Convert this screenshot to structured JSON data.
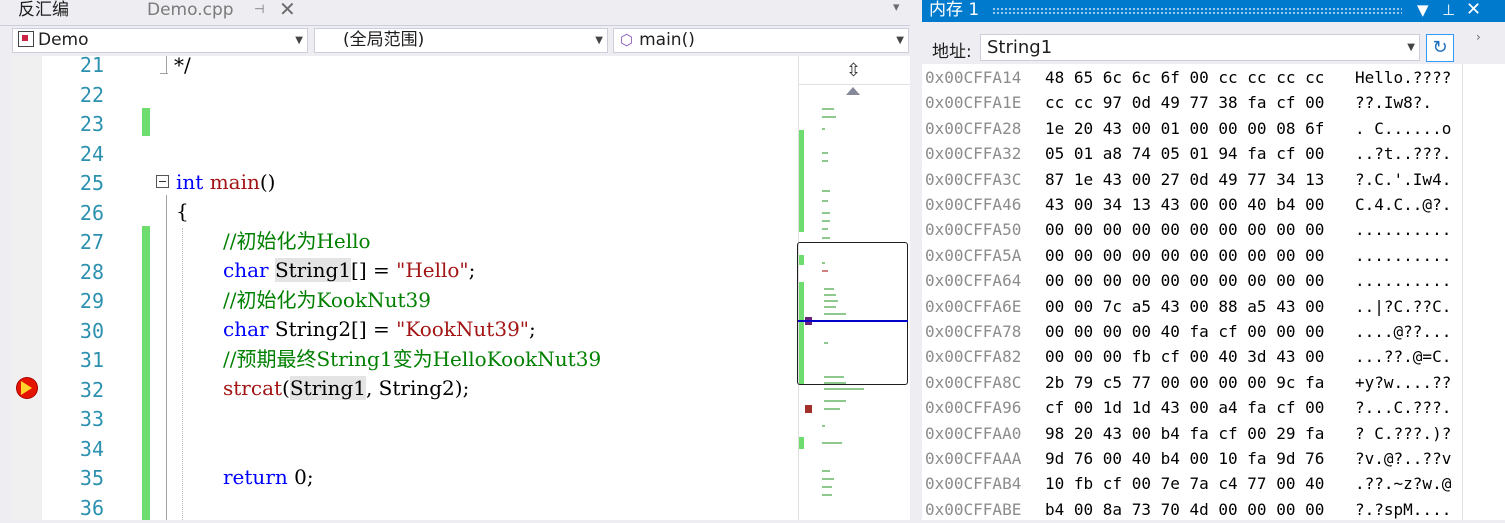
{
  "tabs": {
    "disasm": "反汇编",
    "demo": "Demo.cpp",
    "pin": "⊣",
    "close": "✕",
    "menu": "▾"
  },
  "navbar": {
    "project": "Demo",
    "scope": "(全局范围)",
    "function": "main()"
  },
  "editor": {
    "line_numbers": [
      "21",
      "22",
      "23",
      "24",
      "25",
      "26",
      "27",
      "28",
      "29",
      "30",
      "31",
      "32",
      "33",
      "34",
      "35",
      "36"
    ],
    "code": {
      "l21": "*/",
      "l25_kw": "int",
      "l25_fn": "main",
      "l25_rest": "()",
      "l26": "{",
      "l27": "//初始化为Hello",
      "l28_kw": "char",
      "l28_var": "String1",
      "l28_mid": "[] = ",
      "l28_str": "\"Hello\"",
      "l28_end": ";",
      "l29": "//初始化为KookNut39",
      "l30_kw": "char",
      "l30_mid": " String2[] = ",
      "l30_str": "\"KookNut39\"",
      "l30_end": ";",
      "l31": "//预期最终String1变为HelloKookNut39",
      "l32_fn": "strcat",
      "l32_open": "(",
      "l32_var": "String1",
      "l32_rest": ", String2);",
      "l35_kw": "return",
      "l35_rest": " 0;"
    },
    "breakpoint_line": "32"
  },
  "memory": {
    "title": "内存 1",
    "address_label": "地址:",
    "address_value": "String1",
    "rows": [
      {
        "addr": "0x00CFFA14",
        "hex": "48 65 6c 6c 6f 00 cc cc cc cc",
        "ascii": "Hello.????"
      },
      {
        "addr": "0x00CFFA1E",
        "hex": "cc cc 97 0d 49 77 38 fa cf 00",
        "ascii": "??.Iw8?."
      },
      {
        "addr": "0x00CFFA28",
        "hex": "1e 20 43 00 01 00 00 00 08 6f",
        "ascii": ". C......o"
      },
      {
        "addr": "0x00CFFA32",
        "hex": "05 01 a8 74 05 01 94 fa cf 00",
        "ascii": "..?t..???."
      },
      {
        "addr": "0x00CFFA3C",
        "hex": "87 1e 43 00 27 0d 49 77 34 13",
        "ascii": "?.C.'.Iw4."
      },
      {
        "addr": "0x00CFFA46",
        "hex": "43 00 34 13 43 00 00 40 b4 00",
        "ascii": "C.4.C..@?."
      },
      {
        "addr": "0x00CFFA50",
        "hex": "00 00 00 00 00 00 00 00 00 00",
        "ascii": ".........."
      },
      {
        "addr": "0x00CFFA5A",
        "hex": "00 00 00 00 00 00 00 00 00 00",
        "ascii": ".........."
      },
      {
        "addr": "0x00CFFA64",
        "hex": "00 00 00 00 00 00 00 00 00 00",
        "ascii": ".........."
      },
      {
        "addr": "0x00CFFA6E",
        "hex": "00 00 7c a5 43 00 88 a5 43 00",
        "ascii": "..|?C.??C."
      },
      {
        "addr": "0x00CFFA78",
        "hex": "00 00 00 00 40 fa cf 00 00 00",
        "ascii": "....@??..."
      },
      {
        "addr": "0x00CFFA82",
        "hex": "00 00 00 fb cf 00 40 3d 43 00",
        "ascii": "...??.@=C."
      },
      {
        "addr": "0x00CFFA8C",
        "hex": "2b 79 c5 77 00 00 00 00 9c fa",
        "ascii": "+y?w....??"
      },
      {
        "addr": "0x00CFFA96",
        "hex": "cf 00 1d 1d 43 00 a4 fa cf 00",
        "ascii": "?...C.???."
      },
      {
        "addr": "0x00CFFAA0",
        "hex": "98 20 43 00 b4 fa cf 00 29 fa",
        "ascii": "? C.???.)?"
      },
      {
        "addr": "0x00CFFAAA",
        "hex": "9d 76 00 40 b4 00 10 fa 9d 76",
        "ascii": "?v.@?..??v"
      },
      {
        "addr": "0x00CFFAB4",
        "hex": "10 fb cf 00 7e 7a c4 77 00 40",
        "ascii": ".??.~z?w.@"
      },
      {
        "addr": "0x00CFFABE",
        "hex": "b4 00 8a 73 70 4d 00 00 00 00",
        "ascii": "?.?spM...."
      }
    ]
  },
  "colors": {
    "accent": "#007acc",
    "keyword": "#0000ff",
    "comment": "#008000",
    "string": "#a31515",
    "line_number": "#2b91af",
    "change_bar": "#6fdc6f"
  }
}
